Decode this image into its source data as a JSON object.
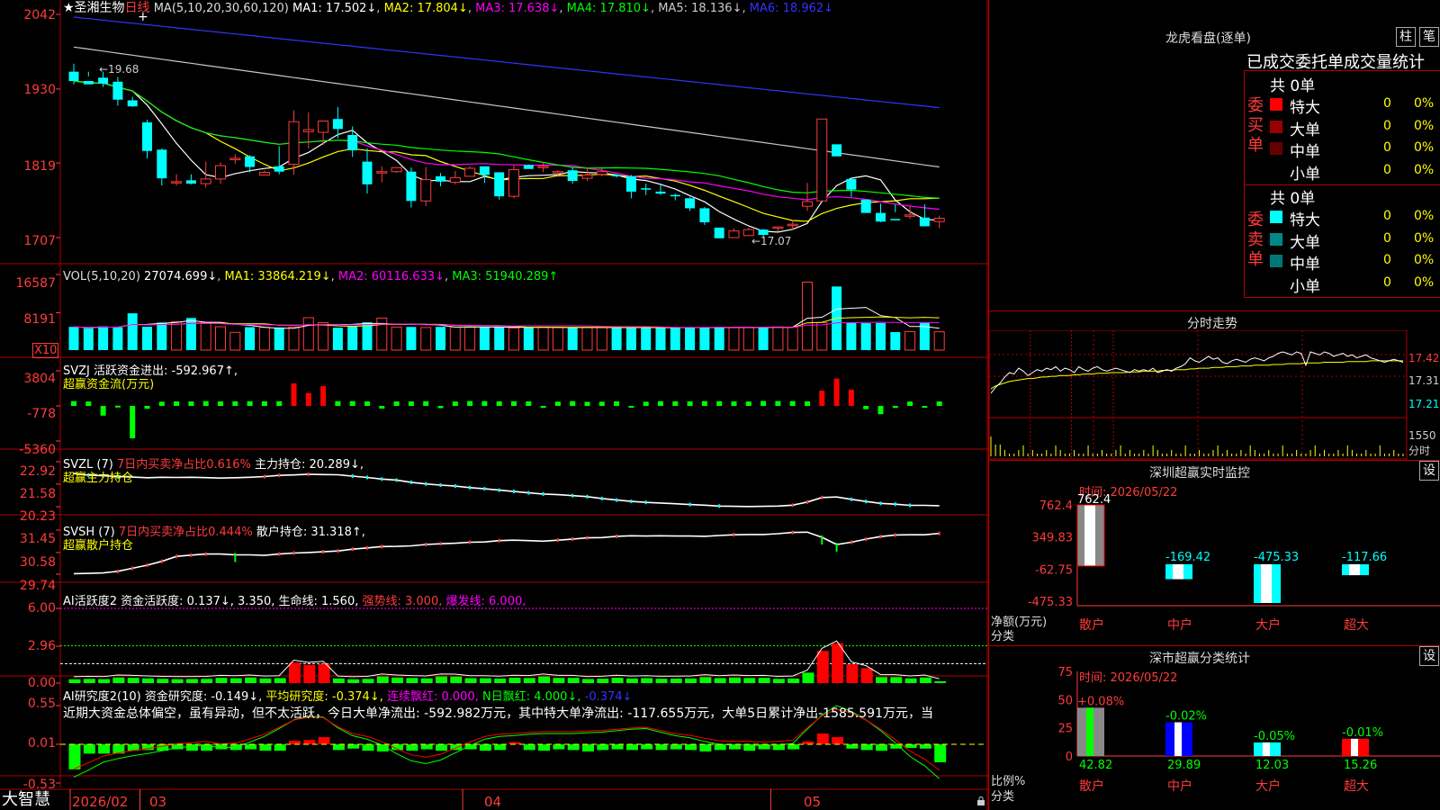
{
  "colors": {
    "up": "#ff3b3b",
    "down": "#00ffff",
    "grid": "#b00000",
    "axis": "#ff3b3b",
    "ma1": "#ffffff",
    "ma2": "#ffff00",
    "ma3": "#ff00ff",
    "ma4": "#00ff00",
    "ma5": "#c8c8c8",
    "ma6": "#3333ff"
  },
  "kline": {
    "title": "★圣湘生物",
    "period": "日线",
    "ma_title": "MA(5,10,20,30,60,120)",
    "ma": [
      {
        "label": "MA1: 17.502↓"
      },
      {
        "label": "MA2: 17.804↓"
      },
      {
        "label": "MA3: 17.638↓"
      },
      {
        "label": "MA4: 17.810↓"
      },
      {
        "label": "MA5: 18.136↓"
      },
      {
        "label": "MA6: 18.962↓"
      }
    ],
    "y_ticks": [
      "2042",
      "1930",
      "1819",
      "1707"
    ],
    "high_label": "←19.68",
    "low_label": "←17.07",
    "candles": [
      [
        19.56,
        19.68,
        19.42,
        19.37
      ],
      [
        19.42,
        19.56,
        19.37,
        19.49
      ],
      [
        19.47,
        19.56,
        19.38,
        19.33
      ],
      [
        19.41,
        19.48,
        19.14,
        19.05
      ],
      [
        19.13,
        19.18,
        19.04,
        19.03
      ],
      [
        18.8,
        18.84,
        18.37,
        18.26
      ],
      [
        18.39,
        18.41,
        17.96,
        17.85
      ],
      [
        17.91,
        18.02,
        17.91,
        17.85
      ],
      [
        17.93,
        18.02,
        17.88,
        17.87
      ],
      [
        17.88,
        18.21,
        17.95,
        17.82
      ],
      [
        17.95,
        18.2,
        18.15,
        17.88
      ],
      [
        18.26,
        18.32,
        18.26,
        18.18
      ],
      [
        18.29,
        18.31,
        18.13,
        18.05
      ],
      [
        18.01,
        18.08,
        18.05,
        18.01
      ],
      [
        18.14,
        18.44,
        18.06,
        18.02
      ],
      [
        18.17,
        18.98,
        18.81,
        18.01
      ],
      [
        18.66,
        18.95,
        18.69,
        18.41
      ],
      [
        18.65,
        18.82,
        18.82,
        18.46
      ],
      [
        18.85,
        19.03,
        18.7,
        18.56
      ],
      [
        18.61,
        18.74,
        18.38,
        18.28
      ],
      [
        18.21,
        18.41,
        17.87,
        17.73
      ],
      [
        18.06,
        18.14,
        18.06,
        17.9
      ],
      [
        18.06,
        18.13,
        18.12,
        18.04
      ],
      [
        18.06,
        18.12,
        17.62,
        17.52
      ],
      [
        17.62,
        18.13,
        17.94,
        17.54
      ],
      [
        17.99,
        18.04,
        17.91,
        17.84
      ],
      [
        17.9,
        18.07,
        17.97,
        17.87
      ],
      [
        17.99,
        18.14,
        18.11,
        17.99
      ],
      [
        18.14,
        18.13,
        18.01,
        17.89
      ],
      [
        18.05,
        18.05,
        17.69,
        17.64
      ],
      [
        17.69,
        18.15,
        18.09,
        17.66
      ],
      [
        18.16,
        18.17,
        18.1,
        18.11
      ],
      [
        18.14,
        18.21,
        18.14,
        18.05
      ],
      [
        18.05,
        18.08,
        18.06,
        17.98
      ],
      [
        18.08,
        18.13,
        17.92,
        17.88
      ],
      [
        17.96,
        18.11,
        18.01,
        17.92
      ],
      [
        18.02,
        18.11,
        18.06,
        17.99
      ],
      [
        18.01,
        18.02,
        18.0,
        17.97
      ],
      [
        17.99,
        18.01,
        17.76,
        17.66
      ],
      [
        17.81,
        17.88,
        17.8,
        17.71
      ],
      [
        17.76,
        17.88,
        17.73,
        17.71
      ],
      [
        17.71,
        17.73,
        17.7,
        17.63
      ],
      [
        17.66,
        17.68,
        17.51,
        17.47
      ],
      [
        17.51,
        17.53,
        17.3,
        17.26
      ],
      [
        17.22,
        17.2,
        17.06,
        17.06
      ],
      [
        17.07,
        17.21,
        17.17,
        17.15
      ],
      [
        17.1,
        17.18,
        17.19,
        17.22
      ],
      [
        17.19,
        17.2,
        17.11,
        17.08
      ],
      [
        17.22,
        17.24,
        17.23,
        17.16
      ],
      [
        17.26,
        17.34,
        17.27,
        17.18
      ],
      [
        17.54,
        17.89,
        17.61,
        17.47
      ],
      [
        17.62,
        18.85,
        18.85,
        18.12
      ],
      [
        18.47,
        18.18,
        18.29,
        18.18
      ],
      [
        17.95,
        17.94,
        17.79,
        17.68
      ],
      [
        17.64,
        17.63,
        17.44,
        17.49
      ],
      [
        17.44,
        17.58,
        17.31,
        17.3
      ],
      [
        17.35,
        17.57,
        17.33,
        17.45
      ],
      [
        17.4,
        17.54,
        17.41,
        17.35
      ],
      [
        17.37,
        17.57,
        17.24,
        17.31
      ],
      [
        17.31,
        17.4,
        17.36,
        17.21
      ]
    ]
  },
  "volume": {
    "header": "VOL(5,10,20)",
    "value": "27074.699↓",
    "ma1": "MA1: 33864.219↓",
    "ma2": "MA2: 60116.633↓",
    "ma3": "MA3: 51940.289↑",
    "y_ticks": [
      "16587",
      "8191"
    ],
    "unit": "X10",
    "values": [
      5093,
      4809,
      5204,
      5000,
      8070,
      5123,
      6038,
      6209,
      7046,
      6082,
      5133,
      3895,
      5037,
      4972,
      4962,
      5090,
      7105,
      6011,
      4906,
      5151,
      6093,
      7021,
      5057,
      5086,
      4954,
      5092,
      5054,
      5046,
      5101,
      5025,
      4858,
      4959,
      5062,
      4951,
      4907,
      4955,
      4936,
      4969,
      4957,
      4942,
      4828,
      4991,
      5006,
      4901,
      5072,
      4980,
      4991,
      4971,
      5076,
      5019,
      14911,
      6030,
      13951,
      6012,
      5910,
      5958,
      3957,
      4057,
      5999,
      4022
    ]
  },
  "svzj": {
    "header": "SVZJ  活跃资金进出: -592.967↑,",
    "subtitle": "超赢资金流(万元)",
    "y_ticks": [
      "3804",
      "-778",
      "-5360"
    ],
    "values": [
      -152,
      -199,
      -2048,
      -749,
      -5014,
      -1151,
      -225,
      -179,
      -192,
      -153,
      -188,
      -171,
      -161,
      -168,
      -164,
      2163,
      901,
      1800,
      -159,
      -149,
      -186,
      -1134,
      -201,
      -195,
      -163,
      -1078,
      -202,
      -139,
      -154,
      -177,
      -167,
      -181,
      -1036,
      -218,
      -149,
      -243,
      -225,
      -179,
      -1005,
      -229,
      -159,
      -174,
      -186,
      -149,
      -159,
      -185,
      -206,
      -136,
      -139,
      -146,
      -178,
      1216,
      2795,
      1355,
      -1204,
      -1858,
      -1046,
      -209,
      -1023,
      -199
    ]
  },
  "svzl": {
    "header_pre": "SVZL (7) ",
    "header_red": "7日内买卖净占比0.616% ",
    "header_white": "主力持仓: 20.289↓,",
    "subtitle": "超赢主力持仓",
    "y_ticks": [
      "22.92",
      "21.58",
      "20.23"
    ],
    "values": [
      22.21,
      22.12,
      22.08,
      22.03,
      22.0,
      21.96,
      21.99,
      21.98,
      21.99,
      21.97,
      21.94,
      21.96,
      21.99,
      22.03,
      22.1,
      22.13,
      22.17,
      22.15,
      22.14,
      22.06,
      21.98,
      21.88,
      21.82,
      21.69,
      21.59,
      21.52,
      21.46,
      21.37,
      21.3,
      21.22,
      21.14,
      21.06,
      20.99,
      20.95,
      20.89,
      20.83,
      20.72,
      20.63,
      20.55,
      20.49,
      20.45,
      20.41,
      20.36,
      20.32,
      20.27,
      20.25,
      20.24,
      20.25,
      20.27,
      20.32,
      20.51,
      20.78,
      20.81,
      20.67,
      20.54,
      20.43,
      20.38,
      20.31,
      20.31,
      20.29
    ]
  },
  "svsh": {
    "header_pre": "SVSH (7) ",
    "header_red": "7日内买卖净占比0.444% ",
    "header_white": "散户持仓: 31.318↑,",
    "subtitle": "超赢散户持仓",
    "y_ticks": [
      "31.45",
      "30.58",
      "29.74"
    ],
    "values": [
      29.76,
      29.77,
      29.79,
      29.85,
      29.97,
      30.09,
      30.24,
      30.43,
      30.48,
      30.52,
      30.52,
      30.49,
      30.49,
      30.47,
      30.52,
      30.56,
      30.58,
      30.61,
      30.64,
      30.71,
      30.76,
      30.81,
      30.82,
      30.84,
      30.89,
      30.92,
      30.94,
      30.98,
      30.99,
      31.04,
      31.06,
      31.04,
      31.02,
      31.06,
      31.1,
      31.15,
      31.16,
      31.21,
      31.23,
      31.22,
      31.23,
      31.22,
      31.22,
      31.21,
      31.24,
      31.27,
      31.28,
      31.28,
      31.31,
      31.36,
      31.37,
      31.17,
      30.89,
      30.98,
      31.1,
      31.2,
      31.26,
      31.27,
      31.27,
      31.32
    ]
  },
  "ai1": {
    "header": "AI活跃度2 资金活跃度: 0.137↓, 3.350, 生命线: 1.560,",
    "strong": "强势线: 3.000,",
    "burst": "爆发线: 6.000,",
    "y_ticks": [
      "6.00",
      "2.96",
      "0.00"
    ],
    "values": [
      0.31,
      0.34,
      0.32,
      0.45,
      0.42,
      0.38,
      0.34,
      0.32,
      0.33,
      0.34,
      0.42,
      0.39,
      0.45,
      0.37,
      0.4,
      1.64,
      1.46,
      1.55,
      0.37,
      0.31,
      0.34,
      0.53,
      0.45,
      0.41,
      0.38,
      0.53,
      0.52,
      0.4,
      0.39,
      0.36,
      0.43,
      0.41,
      0.53,
      0.42,
      0.42,
      0.33,
      0.35,
      0.43,
      0.37,
      0.4,
      0.35,
      0.36,
      0.37,
      0.48,
      0.4,
      0.45,
      0.41,
      0.42,
      0.34,
      0.37,
      0.84,
      2.59,
      3.19,
      1.51,
      1.2,
      0.48,
      0.48,
      0.38,
      0.45,
      0.15
    ]
  },
  "ai2": {
    "header": "AI研究度2(10) 资金研究度: -0.149↓, ",
    "avg": "平均研究度: -0.374↓, ",
    "cont": "连续飘红: 0.000,",
    "n": "N日飘红: 4.000↓,",
    "last": "-0.374↓",
    "note": "近期大资金总体偏空，虽有异动，但不太活跃，今日大单净流出: -592.982万元，其中特大单净流出: -117.655万元，大单5日累计净出-1585.591万元，当",
    "y_ticks": [
      "0.55",
      "0.01",
      "-0.53"
    ],
    "bars": [
      -0.34,
      -0.12,
      -0.12,
      -0.12,
      -0.08,
      -0.07,
      -0.08,
      -0.06,
      -0.08,
      -0.08,
      -0.06,
      -0.07,
      -0.06,
      -0.08,
      -0.08,
      0.06,
      0.07,
      0.11,
      -0.07,
      -0.05,
      -0.08,
      -0.09,
      -0.07,
      -0.08,
      -0.06,
      -0.08,
      -0.07,
      -0.06,
      -0.08,
      -0.07,
      0.04,
      -0.07,
      -0.08,
      -0.06,
      -0.07,
      -0.09,
      -0.07,
      -0.06,
      -0.07,
      -0.06,
      -0.07,
      -0.06,
      -0.07,
      -0.09,
      -0.07,
      -0.06,
      -0.08,
      -0.06,
      -0.07,
      -0.06,
      0.05,
      0.16,
      0.11,
      -0.05,
      -0.07,
      -0.08,
      -0.05,
      -0.04,
      -0.05,
      -0.24
    ],
    "line": [
      -0.45,
      -0.35,
      -0.24,
      -0.19,
      -0.15,
      -0.12,
      -0.08,
      -0.04,
      -0.02,
      0.0,
      -0.04,
      -0.03,
      0.04,
      0.12,
      0.23,
      0.35,
      0.4,
      0.39,
      0.24,
      0.13,
      0.08,
      0.0,
      -0.12,
      -0.22,
      -0.26,
      -0.21,
      -0.11,
      -0.01,
      0.08,
      0.12,
      0.13,
      0.15,
      0.16,
      0.16,
      0.16,
      0.17,
      0.18,
      0.2,
      0.22,
      0.23,
      0.18,
      0.13,
      0.1,
      0.05,
      0.01,
      0.0,
      0.0,
      -0.01,
      0.0,
      0.02,
      0.22,
      0.42,
      0.55,
      0.47,
      0.35,
      0.2,
      0.03,
      -0.16,
      -0.29,
      -0.47
    ]
  },
  "dates": {
    "label0": "2026/02",
    "labels": [
      {
        "text": "03",
        "i": 5
      },
      {
        "text": "04",
        "i": 27
      },
      {
        "text": "05",
        "i": 48
      }
    ]
  },
  "brand": "大智慧",
  "dragon": {
    "title": "龙虎看盘(逐单)",
    "btn1": "柱",
    "btn2": "笔",
    "subtitle": "已成交委托单成交量统计",
    "buy": {
      "label": "委买单",
      "count": "共 0单",
      "rows": [
        {
          "name": "特大",
          "v": "0",
          "p": "0%",
          "c": "#ff0000"
        },
        {
          "name": "大单",
          "v": "0",
          "p": "0%",
          "c": "#990000"
        },
        {
          "name": "中单",
          "v": "0",
          "p": "0%",
          "c": "#660000"
        },
        {
          "name": "小单",
          "v": "0",
          "p": "0%",
          "c": ""
        }
      ]
    },
    "sell": {
      "label": "委卖单",
      "count": "共 0单",
      "rows": [
        {
          "name": "特大",
          "v": "0",
          "p": "0%",
          "c": "#00ffff"
        },
        {
          "name": "大单",
          "v": "0",
          "p": "0%",
          "c": "#008888"
        },
        {
          "name": "中单",
          "v": "0",
          "p": "0%",
          "c": "#007777"
        },
        {
          "name": "小单",
          "v": "0",
          "p": "0%",
          "c": ""
        }
      ]
    }
  },
  "intraday": {
    "title": "分时走势",
    "y": [
      "17.42",
      "17.31",
      "17.21"
    ],
    "vol": "1550",
    "vol_label": "分时",
    "price": [
      17.2,
      17.24,
      17.27,
      17.31,
      17.34,
      17.33,
      17.37,
      17.35,
      17.32,
      17.34,
      17.36,
      17.35,
      17.37,
      17.36,
      17.38,
      17.35,
      17.37,
      17.36,
      17.34,
      17.38,
      17.36,
      17.35,
      17.37,
      17.38,
      17.36,
      17.35,
      17.36,
      17.37,
      17.36,
      17.35,
      17.34,
      17.36,
      17.35,
      17.36,
      17.35,
      17.37,
      17.34,
      17.35,
      17.36,
      17.35,
      17.37,
      17.38,
      17.4,
      17.44,
      17.42,
      17.41,
      17.43,
      17.45,
      17.43,
      17.44,
      17.41,
      17.4,
      17.42,
      17.43,
      17.42,
      17.41,
      17.43,
      17.44,
      17.43,
      17.42,
      17.44,
      17.45,
      17.47,
      17.48,
      17.47,
      17.46,
      17.48,
      17.47,
      17.39,
      17.48,
      17.47,
      17.46,
      17.48,
      17.47,
      17.45,
      17.46,
      17.47,
      17.45,
      17.46,
      17.44,
      17.45,
      17.46,
      17.44,
      17.43,
      17.42,
      17.41,
      17.42,
      17.43,
      17.42,
      17.41
    ],
    "avg": [
      17.23,
      17.25,
      17.26,
      17.27,
      17.28,
      17.285,
      17.29,
      17.295,
      17.3,
      17.3,
      17.305,
      17.31,
      17.31,
      17.315,
      17.315,
      17.32,
      17.32,
      17.32,
      17.325,
      17.325,
      17.33,
      17.33,
      17.33,
      17.335,
      17.335,
      17.335,
      17.34,
      17.34,
      17.34,
      17.34,
      17.345,
      17.345,
      17.345,
      17.35,
      17.35,
      17.35,
      17.35,
      17.355,
      17.355,
      17.355,
      17.36,
      17.36,
      17.36,
      17.365,
      17.365,
      17.37,
      17.37,
      17.37,
      17.375,
      17.375,
      17.375,
      17.38,
      17.38,
      17.38,
      17.385,
      17.385,
      17.385,
      17.39,
      17.39,
      17.39,
      17.39,
      17.395,
      17.395,
      17.395,
      17.4,
      17.4,
      17.4,
      17.4,
      17.405,
      17.405,
      17.405,
      17.405,
      17.41,
      17.41,
      17.41,
      17.41,
      17.41,
      17.415,
      17.415,
      17.415,
      17.415,
      17.415,
      17.42,
      17.42,
      17.42,
      17.42,
      17.42,
      17.42,
      17.42,
      17.42
    ]
  },
  "monitor": {
    "title": "深圳超赢实时监控",
    "btn": "设",
    "time": "时间: 2026/05/22",
    "y": [
      "762.4",
      "349.83",
      "-62.75",
      "-475.33"
    ],
    "ylabel": "净额(万元)",
    "xlabel": "分类",
    "cats": [
      "散户",
      "中户",
      "大户",
      "超大"
    ],
    "values": [
      762.4,
      -169.42,
      -475.33,
      -117.66
    ],
    "labels": [
      "762.4",
      "-169.42",
      "-475.33",
      "-117.66"
    ]
  },
  "classify": {
    "title": "深市超赢分类统计",
    "btn": "设",
    "time": "时间: 2026/05/22",
    "y": [
      "75",
      "50",
      "25",
      "0"
    ],
    "ylabel": "比例%",
    "xlabel": "分类",
    "cats": [
      "散户",
      "中户",
      "大户",
      "超大"
    ],
    "values": [
      42.82,
      29.89,
      12.03,
      15.26
    ],
    "top": [
      "+0.08%",
      "-0.02%",
      "-0.05%",
      "-0.01%"
    ],
    "bottom": [
      "42.82",
      "29.89",
      "12.03",
      "15.26"
    ]
  }
}
